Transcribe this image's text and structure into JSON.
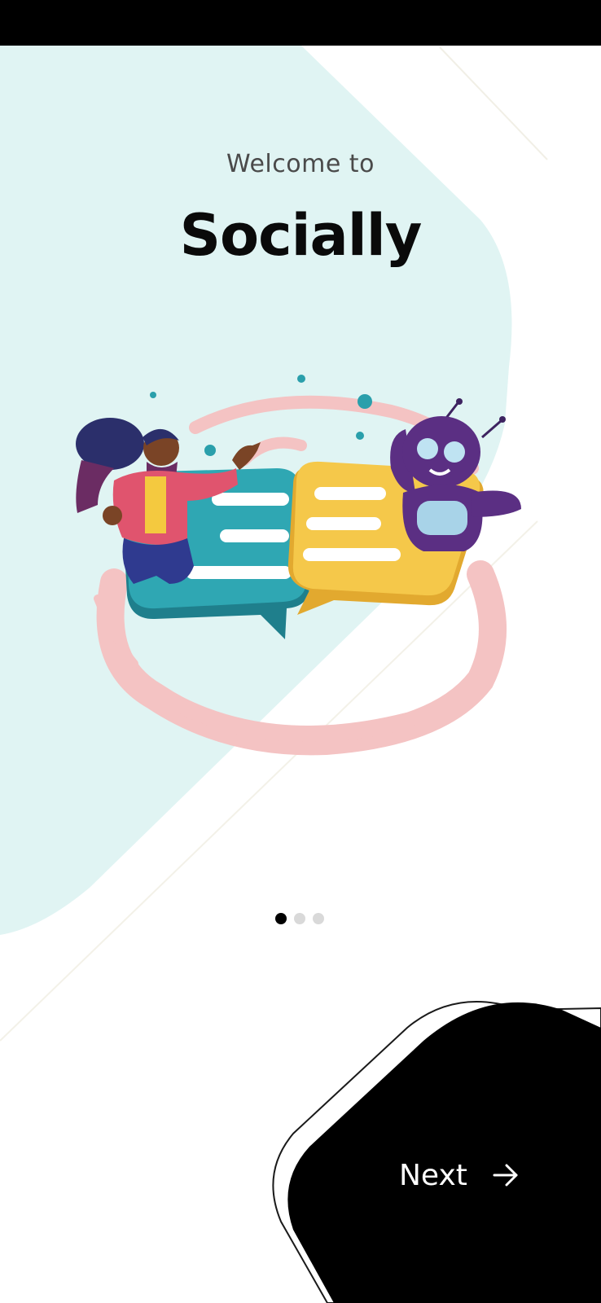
{
  "onboarding": {
    "welcome_text": "Welcome to",
    "app_name": "Socially",
    "page_indicator": {
      "total_pages": 3,
      "current_page": 1
    },
    "next_label": "Next",
    "next_icon": "arrow-right-icon"
  },
  "colors": {
    "status_bar": "#000000",
    "background": "#ffffff",
    "mint_shape": "#e0f4f3",
    "title": "#0a0a0a",
    "subtitle": "#4a4a4a",
    "dot_active": "#000000",
    "dot_inactive": "#d9d9d9",
    "next_button": "#000000",
    "next_text": "#ffffff"
  },
  "illustration": {
    "description_icon": "chat-illustration-icon",
    "elements": [
      "woman-character-icon",
      "robot-character-icon",
      "teal-chat-bubble-icon",
      "yellow-chat-bubble-icon",
      "pink-swirl-icon"
    ]
  }
}
